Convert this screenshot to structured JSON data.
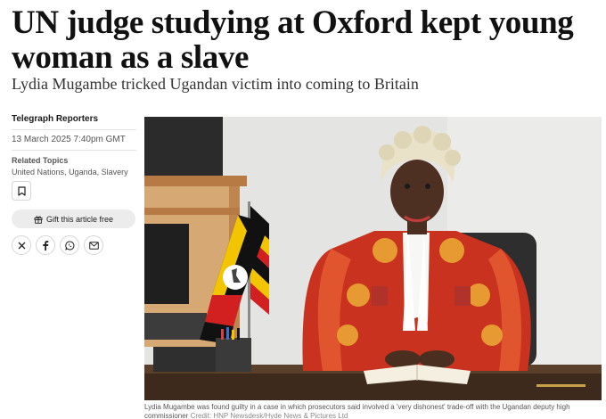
{
  "article": {
    "headline": "UN judge studying at Oxford kept young woman as a slave",
    "standfirst": "Lydia Mugambe tricked Ugandan victim into coming to Britain"
  },
  "meta": {
    "byline": "Telegraph Reporters",
    "date": "13 March 2025 7:40pm GMT",
    "related_heading": "Related Topics",
    "topics": [
      "United Nations",
      "Uganda",
      "Slavery"
    ]
  },
  "actions": {
    "bookmark_icon": "bookmark-icon",
    "gift_label": "Gift this article free",
    "share": [
      {
        "name": "x",
        "glyph": "𝕏"
      },
      {
        "name": "facebook",
        "glyph": "f"
      },
      {
        "name": "whatsapp",
        "glyph": "wa"
      },
      {
        "name": "email",
        "glyph": "mail"
      }
    ]
  },
  "image": {
    "caption": "Lydia Mugambe was found guilty in a case in which prosecutors said involved a 'very dishonest' trade-off with the Ugandan deputy high commissioner",
    "credit": "Credit: HNP Newsdesk/Hyde News & Pictures Ltd"
  },
  "colors": {
    "robe_red": "#c8321f",
    "wig": "#e9e2c8",
    "flag_black": "#111111",
    "flag_yellow": "#f2c500",
    "flag_red": "#d21f1f",
    "wall": "#e6e6e6"
  }
}
